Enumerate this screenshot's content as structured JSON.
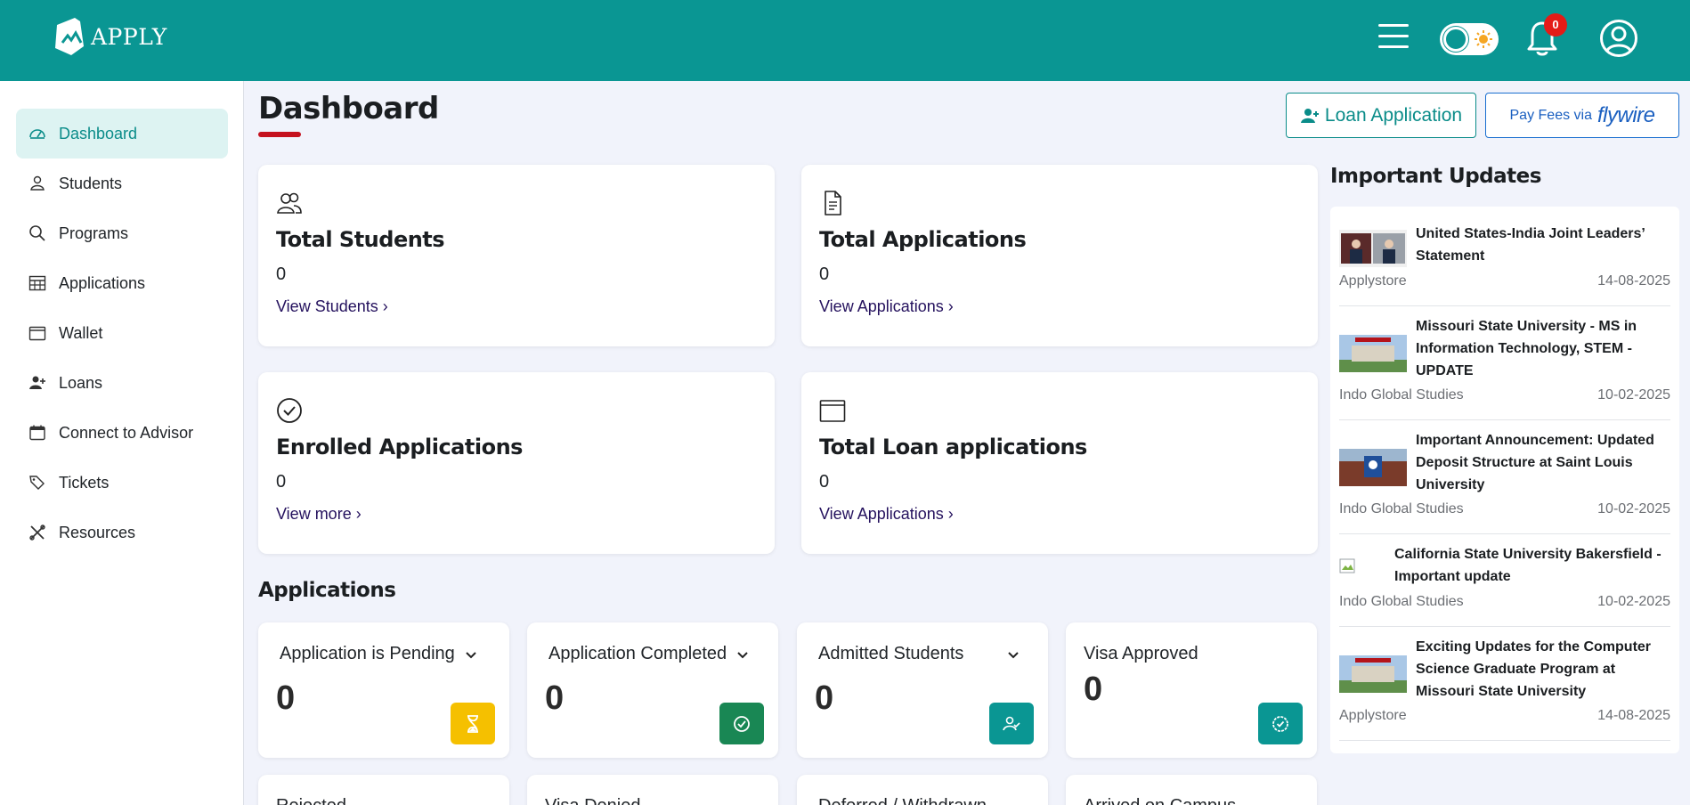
{
  "header": {
    "logo_text": "APPLY",
    "notifications_count": "0"
  },
  "sidebar": {
    "items": [
      {
        "label": "Dashboard",
        "icon": "dashboard-gauge-icon",
        "active": true
      },
      {
        "label": "Students",
        "icon": "person-icon"
      },
      {
        "label": "Programs",
        "icon": "search-icon"
      },
      {
        "label": "Applications",
        "icon": "table-icon"
      },
      {
        "label": "Wallet",
        "icon": "wallet-icon"
      },
      {
        "label": "Loans",
        "icon": "person-plus-icon"
      },
      {
        "label": "Connect to Advisor",
        "icon": "calendar-icon"
      },
      {
        "label": "Tickets",
        "icon": "tags-icon"
      },
      {
        "label": "Resources",
        "icon": "tools-icon"
      }
    ]
  },
  "main": {
    "title": "Dashboard",
    "loan_button": "Loan Application",
    "fees_button_prefix": "Pay Fees via",
    "fees_button_brand": "flywire",
    "stats": [
      {
        "title": "Total Students",
        "value": "0",
        "link": "View Students ›",
        "icon": "people-icon"
      },
      {
        "title": "Total Applications",
        "value": "0",
        "link": "View Applications ›",
        "icon": "document-icon"
      },
      {
        "title": "Enrolled Applications",
        "value": "0",
        "link": "View more ›",
        "icon": "check-circle-icon"
      },
      {
        "title": "Total Loan applications",
        "value": "0",
        "link": "View Applications ›",
        "icon": "wallet-icon"
      }
    ],
    "applications_heading": "Applications",
    "application_cards": [
      {
        "label": "Application is Pending",
        "value": "0",
        "has_dropdown": true,
        "badge_color": "#f5c000",
        "badge_icon": "hourglass-icon"
      },
      {
        "label": "Application Completed",
        "value": "0",
        "has_dropdown": true,
        "badge_color": "#198754",
        "badge_icon": "check-circle-icon"
      },
      {
        "label": "Admitted Students",
        "value": "0",
        "has_dropdown": true,
        "badge_color": "#0a9693",
        "badge_icon": "person-check-icon"
      },
      {
        "label": "Visa Approved",
        "value": "0",
        "has_dropdown": false,
        "badge_color": "#0a9693",
        "badge_icon": "verified-badge-icon"
      }
    ],
    "application_cards_row2": [
      {
        "label": "Rejected"
      },
      {
        "label": "Visa Denied"
      },
      {
        "label": "Deferred / Withdrawn"
      },
      {
        "label": "Arrived on Campus"
      }
    ]
  },
  "updates": {
    "heading": "Important Updates",
    "items": [
      {
        "title": "United States-India Joint Leaders’ Statement",
        "source": "Applystore",
        "date": "14-08-2025"
      },
      {
        "title": "Missouri State University - MS in Information Technology, STEM - UPDATE",
        "source": "Indo Global Studies",
        "date": "10-02-2025"
      },
      {
        "title": "Important Announcement: Updated Deposit Structure at Saint Louis University",
        "source": "Indo Global Studies",
        "date": "10-02-2025"
      },
      {
        "title": "California State University Bakersfield - Important update",
        "source": "Indo Global Studies",
        "date": "10-02-2025"
      },
      {
        "title": "Exciting Updates for the Computer Science Graduate Program at Missouri State University",
        "source": "Applystore",
        "date": "14-08-2025"
      }
    ]
  },
  "colors": {
    "brand": "#0a9693",
    "title_accent": "#c5111e",
    "link": "#25125e",
    "notification_badge": "#e41b17"
  }
}
